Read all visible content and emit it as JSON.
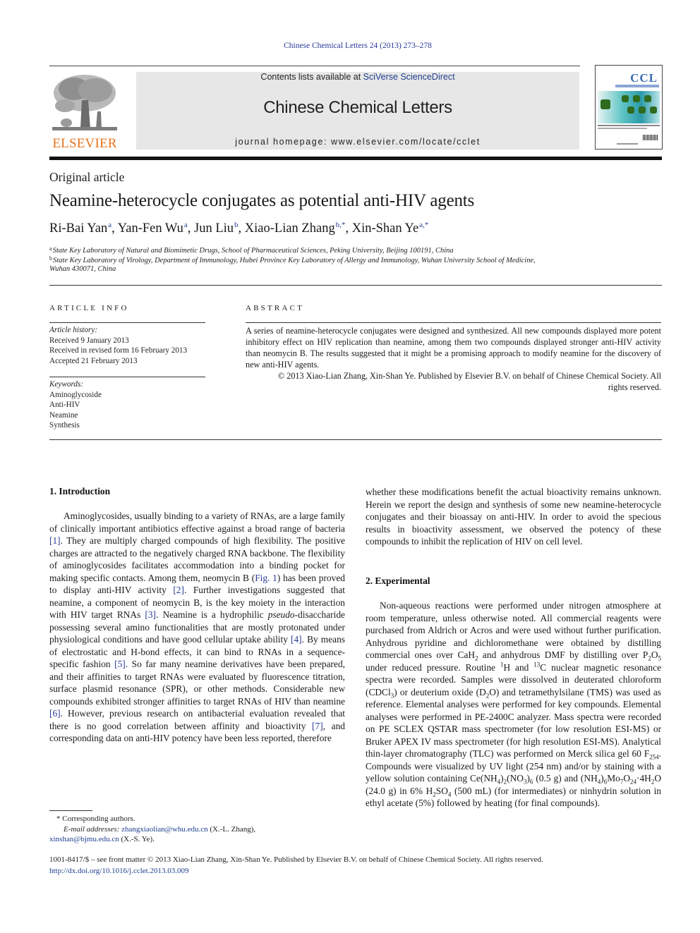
{
  "journal_ref": "Chinese Chemical Letters 24 (2013) 273–278",
  "header": {
    "publisher_logo_text": "ELSEVIER",
    "contents_prefix": "Contents lists available at ",
    "contents_link": "SciVerse ScienceDirect",
    "journal_title": "Chinese Chemical Letters",
    "homepage": "journal homepage: www.elsevier.com/locate/cclet",
    "cover_title": "CCL",
    "colors": {
      "elsevier_orange": "#e8731c",
      "link_blue": "#2a3a99",
      "banner_gray": "#e7e7e7"
    }
  },
  "article": {
    "type": "Original article",
    "title": "Neamine-heterocycle conjugates as potential anti-HIV agents",
    "authors": [
      {
        "name": "Ri-Bai Yan",
        "aff": "a"
      },
      {
        "name": "Yan-Fen Wu",
        "aff": "a"
      },
      {
        "name": "Jun Liu",
        "aff": "b"
      },
      {
        "name": "Xiao-Lian Zhang",
        "aff": "b,*"
      },
      {
        "name": "Xin-Shan Ye",
        "aff": "a,*"
      }
    ],
    "affiliations": [
      {
        "mark": "a",
        "text": "State Key Laboratory of Natural and Biomimetic Drugs, School of Pharmaceutical Sciences, Peking University, Beijing 100191, China"
      },
      {
        "mark": "b",
        "text": "State Key Laboratory of Virology, Department of Immunology, Hubei Province Key Laboratory of Allergy and Immunology, Wuhan University School of Medicine,",
        "cont": "Wuhan 430071, China"
      }
    ]
  },
  "article_info": {
    "heading": "ARTICLE INFO",
    "history_label": "Article history:",
    "history": [
      "Received 9 January 2013",
      "Received in revised form 16 February 2013",
      "Accepted 21 February 2013"
    ],
    "keywords_label": "Keywords:",
    "keywords": [
      "Aminoglycoside",
      "Anti-HIV",
      "Neamine",
      "Synthesis"
    ]
  },
  "abstract": {
    "heading": "ABSTRACT",
    "text": "A series of neamine-heterocycle conjugates were designed and synthesized. All new compounds displayed more potent inhibitory effect on HIV replication than neamine, among them two compounds displayed stronger anti-HIV activity than neomycin B. The results suggested that it might be a promising approach to modify neamine for the discovery of new anti-HIV agents.",
    "copyright": "© 2013 Xiao-Lian Zhang, Xin-Shan Ye. Published by Elsevier B.V. on behalf of Chinese Chemical Society. All rights reserved."
  },
  "intro": {
    "heading": "1.  Introduction",
    "seg": [
      "Aminoglycosides, usually binding to a variety of RNAs, are a large family of clinically important antibiotics effective against a broad range of bacteria ",
      "[1]",
      ". They are multiply charged compounds of high flexibility. The positive charges are attracted to the negatively charged RNA backbone. The flexibility of aminoglycosides facilitates accommodation into a binding pocket for making specific contacts. Among them, neomycin B (",
      "Fig. 1",
      ") has been proved to display anti-HIV activity ",
      "[2]",
      ". Further investigations suggested that neamine, a component of neomycin B, is the key moiety in the interaction with HIV target RNAs ",
      "[3]",
      ". Neamine is a hydrophilic ",
      "pseudo",
      "-disaccharide possessing several amino functionalities that are mostly protonated under physiological conditions and have good cellular uptake ability ",
      "[4]",
      ". By means of electrostatic and H-bond effects, it can bind to RNAs in a sequence-specific fashion ",
      "[5]",
      ". So far many neamine derivatives have been prepared, and their affinities to target RNAs were evaluated by fluorescence titration, surface plasmid resonance (SPR), or other methods. Considerable new compounds exhibited stronger affinities to target RNAs of HIV than neamine ",
      "[6]",
      ". However, previous research on antibacterial evaluation revealed that there is no good correlation between affinity and bioactivity ",
      "[7]",
      ", and corresponding data on anti-HIV potency have been less reported, therefore"
    ],
    "continuation": "whether these modifications benefit the actual bioactivity remains unknown. Herein we report the design and synthesis of some new neamine-heterocycle conjugates and their bioassay on anti-HIV. In order to avoid the specious results in bioactivity assessment, we observed the potency of these compounds to inhibit the replication of HIV on cell level."
  },
  "experimental": {
    "heading": "2.  Experimental",
    "p1": "Non-aqueous reactions were performed under nitrogen atmosphere at room temperature, unless otherwise noted. All commercial reagents were purchased from Aldrich or Acros and were used without further purification. Anhydrous pyridine and dichloromethane were obtained by distilling commercial ones over CaH",
    "p2": " and anhydrous DMF by distilling over P",
    "p3": "O",
    "p4": " under reduced pressure. Routine ",
    "p5": "H and ",
    "p6": "C nuclear magnetic resonance spectra were recorded. Samples were dissolved in deuterated chloroform (CDCl",
    "p7": ") or deuterium oxide (D",
    "p8": "O) and tetramethylsilane (TMS) was used as reference. Elemental analyses were performed for key compounds. Elemental analyses were performed in PE-2400C analyzer. Mass spectra were recorded on PE SCLEX QSTAR mass spectrometer (for low resolution ESI-MS) or Bruker APEX IV mass spectrometer (for high resolution ESI-MS). Analytical thin-layer chromatography (TLC) was performed on Merck silica gel 60 F",
    "p9": ". Compounds were visualized by UV light (254 nm) and/or by staining with a yellow solution containing Ce(NH",
    "p10": ")",
    "p11": "(NO",
    "p12": ")",
    "p13": " (0.5 g) and (NH",
    "p14": ")",
    "p15": "Mo",
    "p16": "O",
    "p17": "·4H",
    "p18": "O (24.0 g) in 6% H",
    "p19": "SO",
    "p20": " (500 mL) (for intermediates) or ninhydrin solution in ethyl acetate (5%) followed by heating (for final compounds).",
    "subs": {
      "two": "2",
      "five": "5",
      "one": "1",
      "thirteen": "13",
      "three": "3",
      "f254": "254",
      "four": "4",
      "six": "6",
      "seven": "7",
      "twentyfour": "24"
    }
  },
  "footnote": {
    "star": "* Corresponding authors.",
    "email_label": "E-mail addresses: ",
    "email1": "zhangxiaolian@whu.edu.cn",
    "email1_who": " (X.-L. Zhang),",
    "email2": "xinshan@bjmu.edu.cn",
    "email2_who": " (X.-S. Ye)."
  },
  "bottom": {
    "issn_line": "1001-8417/$ – see front matter © 2013 Xiao-Lian Zhang, Xin-Shan Ye. Published by Elsevier B.V. on behalf of Chinese Chemical Society. All rights reserved.",
    "doi": "http://dx.doi.org/10.1016/j.cclet.2013.03.009"
  }
}
